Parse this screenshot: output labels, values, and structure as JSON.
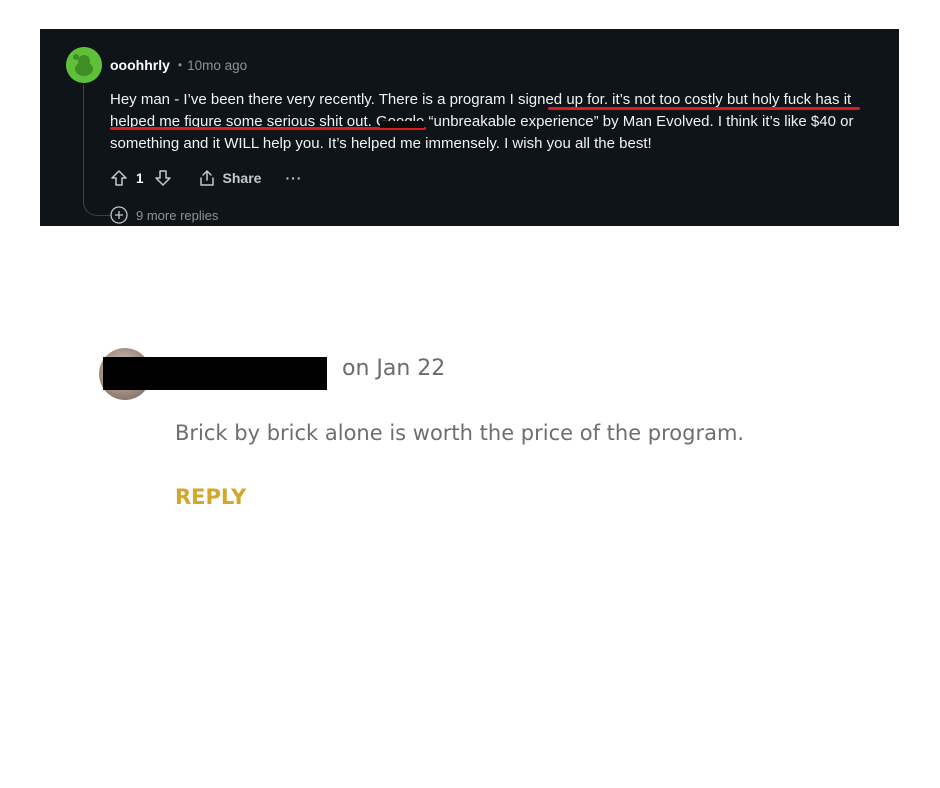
{
  "reddit_comment": {
    "username": "ooohhrly",
    "separator": "•",
    "age": "10mo ago",
    "body": "Hey man - I’ve been there very recently. There is a program I signed up for. it’s not too costly but holy fuck has it helped me figure some serious shit out. Google “unbreakable experience” by Man Evolved. I think it’s like $40 or something and it WILL help you. It’s helped me immensely. I wish you all the best!",
    "vote_count": "1",
    "share_label": "Share",
    "more_label": "···",
    "more_replies_label": "9 more replies",
    "avatar_color": "#5fc13a",
    "highlight_color": "#e01b1b"
  },
  "testimonial": {
    "date": "on Jan 22",
    "body": "Brick by brick alone is worth the price of the program.",
    "reply_label": "REPLY",
    "reply_color": "#d4a62a"
  }
}
